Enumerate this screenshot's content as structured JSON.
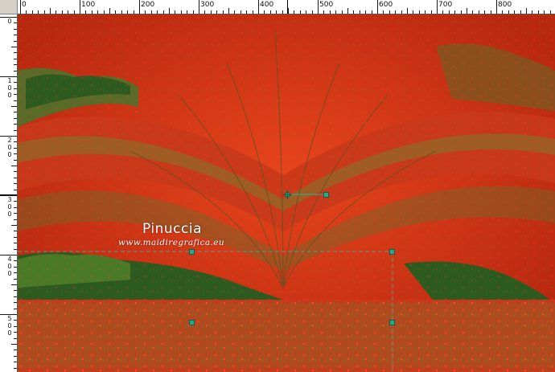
{
  "ruler": {
    "horizontal_labels": [
      "0",
      "100",
      "200",
      "300",
      "400",
      "500",
      "600",
      "700",
      "800"
    ],
    "vertical_labels": [
      {
        "digits": [
          "0"
        ]
      },
      {
        "digits": [
          "1",
          "0",
          "0"
        ]
      },
      {
        "digits": [
          "2",
          "0",
          "0"
        ]
      },
      {
        "digits": [
          "3",
          "0",
          "0"
        ]
      },
      {
        "digits": [
          "4",
          "0",
          "0"
        ]
      },
      {
        "digits": [
          "5",
          "0",
          "0"
        ]
      },
      {
        "digits": [
          "6"
        ]
      }
    ]
  },
  "watermark": {
    "name": "Pinuccia",
    "url": "www.maidiregrafica.eu"
  },
  "colors": {
    "field": "#d8321a",
    "field_dark": "#a82410",
    "grass": "#5a6a28",
    "trees": "#2d5a1e",
    "selection": "#3a8a7a",
    "handle": "#2aa888"
  },
  "tool": {
    "name": "pick-tool",
    "handles": [
      "top-center",
      "top-right",
      "middle-left",
      "middle-right",
      "center",
      "pivot",
      "rotate-handle"
    ]
  }
}
